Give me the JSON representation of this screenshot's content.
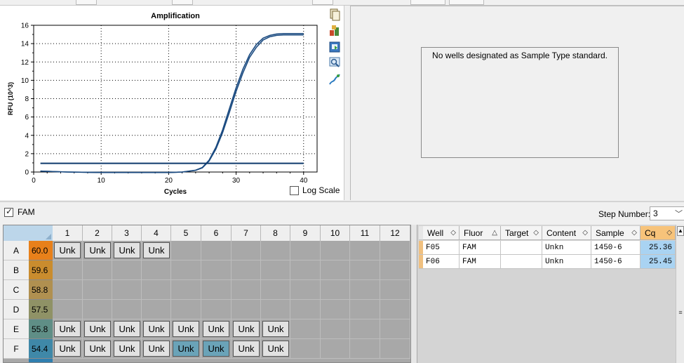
{
  "chart": {
    "title": "Amplification",
    "xlabel": "Cycles",
    "ylabel": "RFU (10^3)",
    "log_scale_label": "Log Scale",
    "log_scale_checked": false
  },
  "chart_data": {
    "type": "line",
    "title": "Amplification",
    "xlabel": "Cycles",
    "ylabel": "RFU (10^3)",
    "xlim": [
      0,
      41
    ],
    "ylim": [
      0,
      16
    ],
    "xticks": [
      "0",
      "10",
      "20",
      "30",
      "40"
    ],
    "yticks": [
      "0",
      "2",
      "4",
      "6",
      "8",
      "10",
      "12",
      "14",
      "16"
    ],
    "grid": true,
    "series": [
      {
        "x": [
          1,
          5,
          10,
          15,
          20,
          22,
          24,
          25,
          26,
          27,
          28,
          29,
          30,
          31,
          32,
          33,
          34,
          35,
          36,
          37,
          38,
          40
        ],
        "values": [
          0.1,
          0.0,
          -0.05,
          -0.05,
          -0.05,
          0.0,
          0.2,
          0.5,
          1.3,
          2.7,
          4.6,
          6.9,
          9.2,
          11.2,
          12.8,
          13.9,
          14.6,
          14.9,
          15.05,
          15.1,
          15.1,
          15.1
        ]
      },
      {
        "x": [
          1,
          5,
          10,
          15,
          20,
          22,
          24,
          25,
          26,
          27,
          28,
          29,
          30,
          31,
          32,
          33,
          34,
          35,
          36,
          37,
          38,
          40
        ],
        "values": [
          0.1,
          0.0,
          -0.05,
          -0.05,
          -0.05,
          0.0,
          0.18,
          0.45,
          1.2,
          2.5,
          4.3,
          6.5,
          8.8,
          10.8,
          12.5,
          13.6,
          14.4,
          14.75,
          14.9,
          14.95,
          14.95,
          14.95
        ]
      },
      {
        "x": [
          1,
          40
        ],
        "values": [
          0.95,
          0.95
        ],
        "threshold": true
      }
    ]
  },
  "toolbar_icons": [
    "copy-icon",
    "export-icon",
    "save-image-icon",
    "magnify-icon",
    "chart-settings-icon"
  ],
  "standard_curve": {
    "message": "No wells designated as Sample Type standard."
  },
  "fluor_filter": {
    "label": "FAM",
    "checked": true
  },
  "step": {
    "label": "Step Number:",
    "value": "3"
  },
  "plate": {
    "columns": [
      "1",
      "2",
      "3",
      "4",
      "5",
      "6",
      "7",
      "8",
      "9",
      "10",
      "11",
      "12"
    ],
    "rows": [
      {
        "label": "A",
        "temp": "60.0",
        "color": "#e8801a",
        "wells": [
          "Unk",
          "Unk",
          "Unk",
          "Unk",
          "",
          "",
          "",
          "",
          "",
          "",
          "",
          ""
        ]
      },
      {
        "label": "B",
        "temp": "59.6",
        "color": "#c98c2e",
        "wells": [
          "",
          "",
          "",
          "",
          "",
          "",
          "",
          "",
          "",
          "",
          "",
          ""
        ]
      },
      {
        "label": "C",
        "temp": "58.8",
        "color": "#b09050",
        "wells": [
          "",
          "",
          "",
          "",
          "",
          "",
          "",
          "",
          "",
          "",
          "",
          ""
        ]
      },
      {
        "label": "D",
        "temp": "57.5",
        "color": "#8f9266",
        "wells": [
          "",
          "",
          "",
          "",
          "",
          "",
          "",
          "",
          "",
          "",
          "",
          ""
        ]
      },
      {
        "label": "E",
        "temp": "55.8",
        "color": "#5f8e86",
        "wells": [
          "Unk",
          "Unk",
          "Unk",
          "Unk",
          "Unk",
          "Unk",
          "Unk",
          "Unk",
          "",
          "",
          "",
          ""
        ]
      },
      {
        "label": "F",
        "temp": "54.4",
        "color": "#3f88a8",
        "wells": [
          "Unk",
          "Unk",
          "Unk",
          "Unk",
          "Unk",
          "Unk",
          "Unk",
          "Unk",
          "",
          "",
          "",
          ""
        ]
      }
    ],
    "selected": [
      "F5",
      "F6"
    ]
  },
  "results": {
    "headers": [
      "Well",
      "Fluor",
      "Target",
      "Content",
      "Sample",
      "Cq"
    ],
    "rows": [
      [
        "F05",
        "FAM",
        "",
        "Unkn",
        "1450-6",
        "25.36"
      ],
      [
        "F06",
        "FAM",
        "",
        "Unkn",
        "1450-6",
        "25.45"
      ]
    ]
  }
}
